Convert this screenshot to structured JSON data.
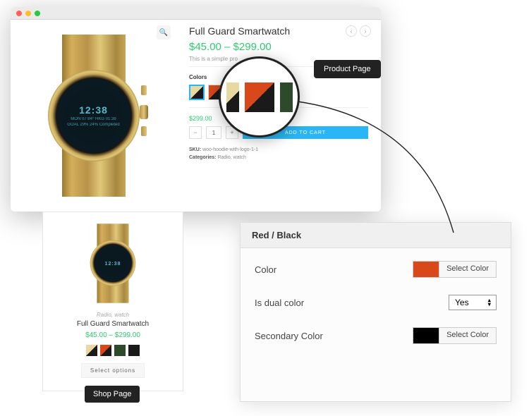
{
  "labels": {
    "productPage": "Product Page",
    "shopPage": "Shop Page"
  },
  "product": {
    "title": "Full Guard Smartwatch",
    "priceRange": "$45.00 – $299.00",
    "description": "This is a simple pro",
    "colorsLabel": "Colors",
    "variantPrice": "$299.00",
    "qty": "1",
    "addToCart": "ADD TO CART",
    "skuLabel": "SKU:",
    "sku": "woo-hoodie-with-logo-1-1",
    "catLabel": "Categories:",
    "categories": "Radio, watch",
    "watchFace": {
      "time": "12:38",
      "row1": "MON 07  84°  HKG 01:38",
      "row2": "GOAL 29%  24% Completed"
    }
  },
  "shop": {
    "category": "Radio, watch",
    "title": "Full Guard Smartwatch",
    "price": "$45.00 – $299.00",
    "selectOptions": "Select options"
  },
  "settings": {
    "header": "Red / Black",
    "colorLabel": "Color",
    "colorValue": "#d8481a",
    "selectColor": "Select Color",
    "dualLabel": "Is dual color",
    "dualValue": "Yes",
    "secondaryLabel": "Secondary Color",
    "secondaryValue": "#000000"
  },
  "swatches": {
    "product": [
      {
        "c1": "#e8d9a0",
        "c2": "#1a1a1a",
        "selected": true
      },
      {
        "c1": "#d8481a",
        "c2": "#1a1a1a"
      },
      {
        "c1": "#2d4a2a",
        "c2": "#2d4a2a"
      },
      {
        "c1": "#1a1a1a",
        "c2": "#1a1a1a"
      }
    ],
    "shop": [
      {
        "c1": "#e8d9a0",
        "c2": "#1a1a1a"
      },
      {
        "c1": "#d8481a",
        "c2": "#1a1a1a"
      },
      {
        "c1": "#2d4a2a",
        "c2": "#2d4a2a"
      },
      {
        "c1": "#1a1a1a",
        "c2": "#1a1a1a"
      }
    ]
  }
}
